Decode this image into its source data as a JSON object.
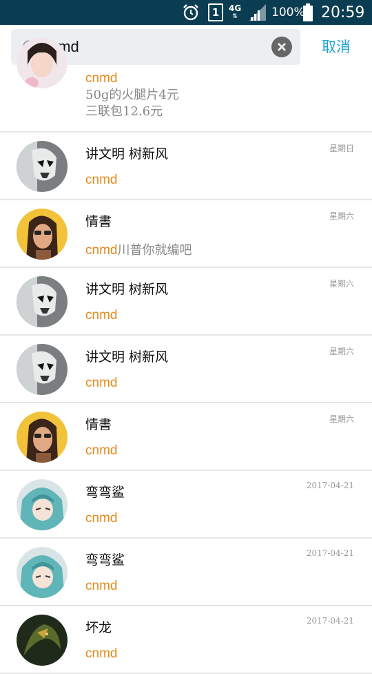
{
  "status_bar": {
    "icons": [
      "alarm-icon",
      "sim-icon",
      "4g-icon",
      "signal-icon",
      "battery-icon"
    ],
    "sim_number": "1",
    "network": "4G",
    "battery": "100%",
    "time": "20:59"
  },
  "search": {
    "query": "cnmd",
    "cancel_label": "取消"
  },
  "colors": {
    "highlight": "#e38a1c",
    "accent": "#1aa0d8",
    "statusbar": "#0b3d52"
  },
  "results": [
    {
      "avatar": "girl-avatar",
      "name": "",
      "date": "",
      "match": "cnmd",
      "lines": [
        "50g的火腿片4元",
        "三联包12.6元"
      ]
    },
    {
      "avatar": "stormtrooper-avatar",
      "name": "讲文明 树新风",
      "date": "星期日",
      "match": "cnmd",
      "rest": ""
    },
    {
      "avatar": "anime-girl-glasses-avatar",
      "name": "情書",
      "date": "星期六",
      "match": "cnmd",
      "rest": "川普你就编吧"
    },
    {
      "avatar": "stormtrooper-avatar",
      "name": "讲文明 树新风",
      "date": "星期六",
      "match": "cnmd",
      "rest": ""
    },
    {
      "avatar": "stormtrooper-avatar",
      "name": "讲文明 树新风",
      "date": "星期六",
      "match": "cnmd",
      "rest": ""
    },
    {
      "avatar": "anime-girl-glasses-avatar",
      "name": "情書",
      "date": "星期六",
      "match": "cnmd",
      "rest": ""
    },
    {
      "avatar": "teal-hair-avatar",
      "name": "弯弯鲨",
      "date": "2017-04-21",
      "match": "cnmd",
      "rest": ""
    },
    {
      "avatar": "teal-hair-avatar",
      "name": "弯弯鲨",
      "date": "2017-04-21",
      "match": "cnmd",
      "rest": ""
    },
    {
      "avatar": "dragon-avatar",
      "name": "坏龙",
      "date": "2017-04-21",
      "match": "cnmd",
      "rest": ""
    }
  ]
}
